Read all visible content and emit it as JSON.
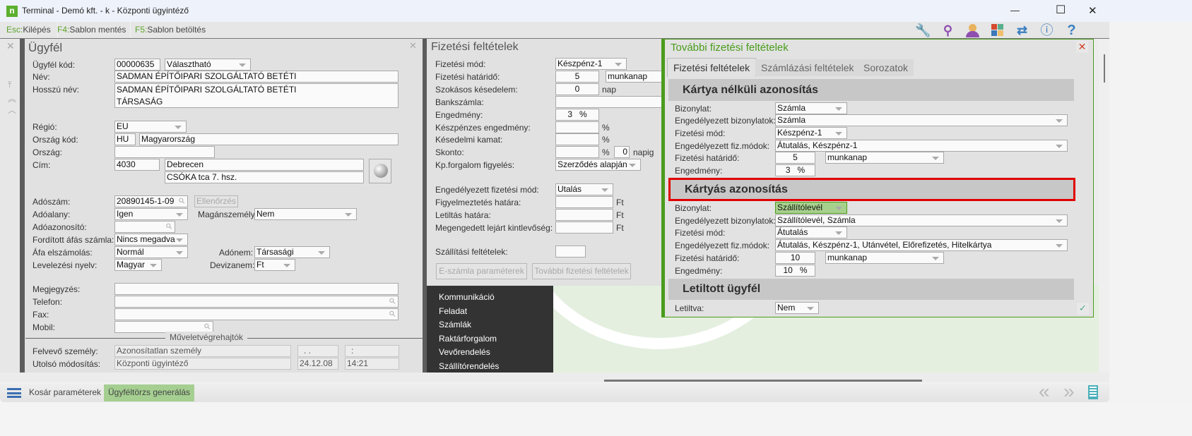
{
  "window": {
    "title": "Terminal - Demó kft. - k - Központi ügyintéző",
    "minimize": "—",
    "maximize": "☐",
    "close": "✕"
  },
  "toolbar": {
    "items": [
      {
        "key": "Esc:",
        "label": "Kilépés"
      },
      {
        "key": "F4:",
        "label": "Sablon mentés"
      },
      {
        "key": "F5:",
        "label": "Sablon betöltés"
      }
    ],
    "icons": [
      "wrench-icon",
      "search-icon",
      "user-icon",
      "grid-icon",
      "swap-icon",
      "info-icon",
      "help-icon"
    ]
  },
  "customer": {
    "title": "Ügyfél",
    "labels": {
      "code": "Ügyfél kód:",
      "name": "Név:",
      "long_name": "Hosszú név:",
      "region": "Régió:",
      "country_code": "Ország kód:",
      "country": "Ország:",
      "address": "Cím:",
      "tax_no": "Adószám:",
      "taxable": "Adóalany:",
      "private": "Magánszemély:",
      "tax_id": "Adóazonosító:",
      "reverse_vat": "Fordított áfás számla:",
      "vat_acc": "Áfa elszámolás:",
      "tax_type": "Adónem:",
      "language": "Levelezési nyelv:",
      "currency": "Devizanem:",
      "note": "Megjegyzés:",
      "phone": "Telefon:",
      "fax": "Fax:",
      "mobile": "Mobil:",
      "operators": "Műveletvégrehajtók",
      "created_by": "Felvevő személy:",
      "modified": "Utolsó módosítás:"
    },
    "values": {
      "code": "00000635",
      "code_type": "Választható",
      "name": "SADMAN ÉPÍTŐIPARI SZOLGÁLTATÓ BETÉTI",
      "long_name_1": "SADMAN ÉPÍTŐIPARI SZOLGÁLTATÓ BETÉTI",
      "long_name_2": "TÁRSASÁG",
      "region": "EU",
      "country_code": "HU",
      "country_name": "Magyarország",
      "country": "",
      "zip": "4030",
      "city": "Debrecen",
      "street": "CSÓKA tca 7. hsz.",
      "tax_no": "20890145-1-09",
      "check_button": "Ellenőrzés",
      "taxable": "Igen",
      "private": "Nem",
      "tax_id": "",
      "reverse_vat": "Nincs megadva",
      "vat_acc": "Normál",
      "tax_type": "Társasági",
      "language": "Magyar",
      "currency": "Ft",
      "created_by": "Azonosítatlan személy",
      "created_date": ". .",
      "created_time": ":",
      "modified_by": "Központi ügyintéző",
      "modified_date": "24.12.08",
      "modified_time": "14:21"
    }
  },
  "payment": {
    "title": "Fizetési feltételek",
    "labels": {
      "mode": "Fizetési mód:",
      "deadline": "Fizetési határidő:",
      "delay": "Szokásos késedelem:",
      "bank": "Bankszámla:",
      "discount": "Engedmény:",
      "cash_discount": "Készpénzes engedmény:",
      "interest": "Késedelmi kamat:",
      "skonto": "Skonto:",
      "cash_watch": "Kp.forgalom figyelés:",
      "allowed_mode": "Engedélyezett fizetési mód:",
      "warn_limit": "Figyelmeztetés határa:",
      "block_limit": "Letiltás határa:",
      "overdue": "Megengedett lejárt kintlevőség:",
      "shipping": "Szállítási feltételek:"
    },
    "values": {
      "mode": "Készpénz-1",
      "deadline": "5",
      "deadline_unit": "munkanap",
      "delay": "0",
      "delay_unit": "nap",
      "discount": "3   %",
      "pct": "%",
      "skonto_days": "0",
      "napig": "napig",
      "cash_watch": "Szerződés alapján",
      "allowed_mode": "Utalás",
      "ft": "Ft"
    },
    "buttons": {
      "einvoice": "E-számla paraméterek",
      "more": "További fizetési feltételek"
    }
  },
  "side_menu": [
    "Kommunikáció",
    "Feladat",
    "Számlák",
    "Raktárforgalom",
    "Vevőrendelés",
    "Szállítórendelés"
  ],
  "dialog": {
    "title": "További fizetési feltételek",
    "tabs": [
      "Fizetési feltételek",
      "Számlázási feltételek",
      "Sorozatok"
    ],
    "labels": {
      "doc": "Bizonylat:",
      "allowed_docs": "Engedélyezett bizonylatok:",
      "mode": "Fizetési mód:",
      "allowed_modes": "Engedélyezett fiz.módok:",
      "deadline": "Fizetési határidő:",
      "discount": "Engedmény:",
      "blocked": "Letiltva:"
    },
    "sections": [
      {
        "title": "Kártya nélküli azonosítás",
        "doc": "Számla",
        "allowed_docs": "Számla",
        "mode": "Készpénz-1",
        "allowed_modes": "Átutalás, Készpénz-1",
        "deadline": "5",
        "unit": "munkanap",
        "discount": "3   %"
      },
      {
        "title": "Kártyás azonosítás",
        "doc": "Szállítólevél",
        "allowed_docs": "Szállítólevél, Számla",
        "mode": "Átutalás",
        "allowed_modes": "Átutalás, Készpénz-1, Utánvétel, Előrefizetés, Hitelkártya",
        "deadline": "10",
        "unit": "munkanap",
        "discount": "10   %"
      },
      {
        "title": "Letiltott ügyfél",
        "blocked": "Nem"
      }
    ],
    "close": "✕",
    "ok": "✓"
  },
  "bottom": {
    "menu": "Kosár paraméterek",
    "generate": "Ügyféltörzs generálás",
    "prev": "«",
    "next": "»"
  },
  "colors": {
    "green": "#4a9c1c",
    "highlight": "#e00000",
    "menu_bg": "#333333"
  }
}
